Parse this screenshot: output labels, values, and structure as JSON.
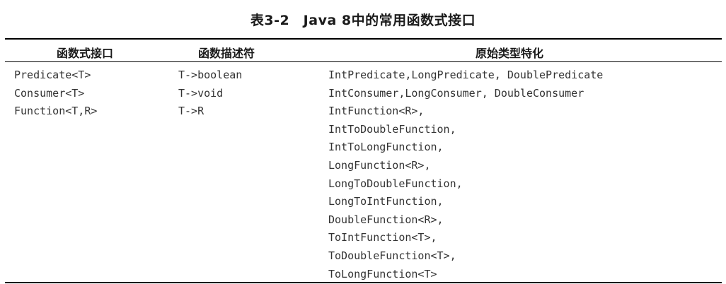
{
  "table": {
    "title": "表3-2　Java 8中的常用函数式接口",
    "headers": {
      "interface": "函数式接口",
      "descriptor": "函数描述符",
      "specializations": "原始类型特化"
    },
    "rows": [
      {
        "interface": "Predicate<T>",
        "descriptor": "T->boolean",
        "specializations": [
          "IntPredicate,LongPredicate, DoublePredicate"
        ]
      },
      {
        "interface": "Consumer<T>",
        "descriptor": "T->void",
        "specializations": [
          "IntConsumer,LongConsumer, DoubleConsumer"
        ]
      },
      {
        "interface": "Function<T,R>",
        "descriptor": "T->R",
        "specializations": [
          "IntFunction<R>,",
          "IntToDoubleFunction,",
          "IntToLongFunction,",
          "LongFunction<R>,",
          "LongToDoubleFunction,",
          "LongToIntFunction,",
          "DoubleFunction<R>,",
          "ToIntFunction<T>,",
          "ToDoubleFunction<T>,",
          "ToLongFunction<T>"
        ]
      }
    ]
  }
}
